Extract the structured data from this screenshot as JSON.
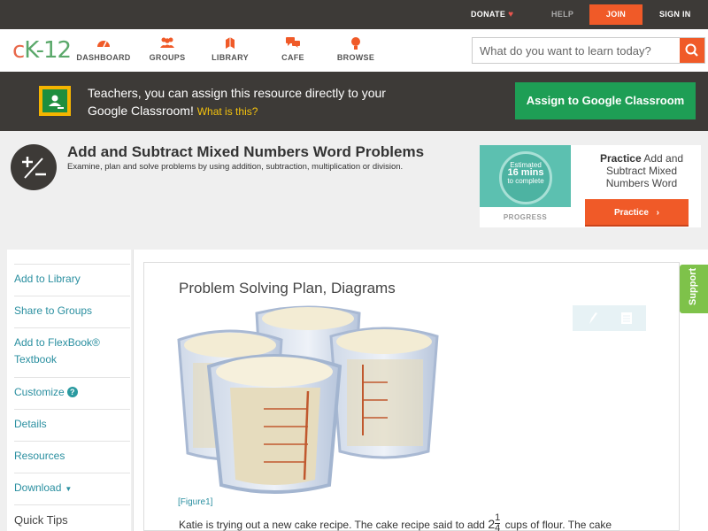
{
  "topbar": {
    "donate": "DONATE",
    "help": "HELP",
    "join": "JOIN",
    "signin": "SIGN IN"
  },
  "nav": {
    "logo_c": "c",
    "logo_k": "K-12",
    "items": [
      {
        "label": "DASHBOARD",
        "icon": "dashboard-icon"
      },
      {
        "label": "GROUPS",
        "icon": "groups-icon"
      },
      {
        "label": "LIBRARY",
        "icon": "library-icon"
      },
      {
        "label": "CAFE",
        "icon": "cafe-icon"
      },
      {
        "label": "BROWSE",
        "icon": "browse-icon"
      }
    ],
    "search_placeholder": "What do you want to learn today?"
  },
  "banner": {
    "text": "Teachers, you can assign this resource directly to your Google Classroom!",
    "link": "What is this?",
    "button": "Assign to Google Classroom"
  },
  "header": {
    "title": "Add and Subtract Mixed Numbers Word Problems",
    "subtitle": "Examine, plan and solve problems by using addition, subtraction, multiplication or division."
  },
  "practice": {
    "estimated": "Estimated",
    "mins": "16 mins",
    "to_complete": "to complete",
    "progress_label": "PROGRESS",
    "card_bold": "Practice",
    "card_text": "Add and Subtract Mixed Numbers Word",
    "button": "Practice"
  },
  "sidebar": {
    "add_library": "Add to Library",
    "share_groups": "Share to Groups",
    "add_flexbook": "Add to FlexBook® Textbook",
    "customize": "Customize",
    "details": "Details",
    "resources": "Resources",
    "download": "Download",
    "quick_tips": "Quick Tips"
  },
  "content": {
    "section_title": "Problem Solving Plan, Diagrams",
    "figure_caption": "[Figure1]",
    "body_before": "Katie is trying out a new cake recipe. The cake recipe said to add",
    "whole": "2",
    "numerator": "1",
    "denominator": "4",
    "body_after": "cups of flour. The cake"
  },
  "support": "Support",
  "colors": {
    "accent": "#f05a28",
    "dark": "#3d3a37",
    "green": "#1e9e55",
    "link": "#2a8fa0"
  }
}
